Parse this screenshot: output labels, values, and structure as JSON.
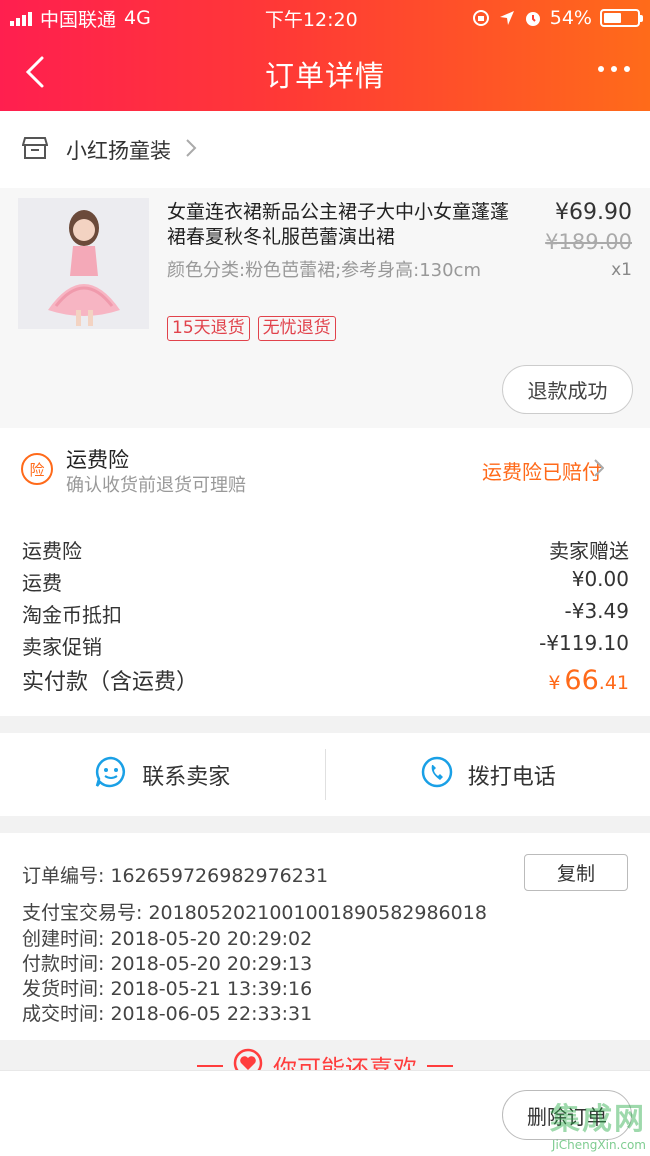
{
  "status_bar": {
    "carrier": "中国联通",
    "network": "4G",
    "time": "下午12:20",
    "battery": "54%",
    "battery_level": 0.54
  },
  "nav": {
    "title": "订单详情"
  },
  "shop": {
    "name": "小红扬童装"
  },
  "product": {
    "title": "女童连衣裙新品公主裙子大中小女童蓬蓬裙春夏秋冬礼服芭蕾演出裙",
    "sku": "颜色分类:粉色芭蕾裙;参考身高:130cm",
    "price": "¥69.90",
    "original_price": "¥189.00",
    "quantity": "x1",
    "tags": [
      "15天退货",
      "无忧退货"
    ],
    "refund_status": "退款成功"
  },
  "insurance": {
    "icon_text": "险",
    "title": "运费险",
    "subtitle": "确认收货前退货可理赔",
    "status": "运费险已赔付"
  },
  "fees": [
    {
      "label": "运费险",
      "value": "卖家赠送"
    },
    {
      "label": "运费",
      "value": "¥0.00"
    },
    {
      "label": "淘金币抵扣",
      "value": "-¥3.49"
    },
    {
      "label": "卖家促销",
      "value": "-¥119.10"
    }
  ],
  "total": {
    "label": "实付款（含运费）",
    "currency": "¥",
    "integer": "66",
    "decimal": ".41"
  },
  "contact": {
    "seller_label": "联系卖家",
    "call_label": "拨打电话"
  },
  "order_info": {
    "order_no": "订单编号:  162659726982976231",
    "copy_label": "复制",
    "alipay_no": "支付宝交易号:  2018052021001001890582986018",
    "created": "创建时间:  2018-05-20 20:29:02",
    "paid": "付款时间:  2018-05-20 20:29:13",
    "shipped": "发货时间:  2018-05-21 13:39:16",
    "completed": "成交时间:  2018-06-05 22:33:31"
  },
  "recommend": {
    "title": "你可能还喜欢"
  },
  "bottom": {
    "delete_label": "删除订单"
  },
  "watermark": {
    "main": "集成网",
    "sub": "JiChengXin.com"
  },
  "colors": {
    "accent": "#ff6a1a",
    "brand_red": "#ff1f4f",
    "tag_red": "#e1424b",
    "contact_blue": "#1aa0e6"
  }
}
